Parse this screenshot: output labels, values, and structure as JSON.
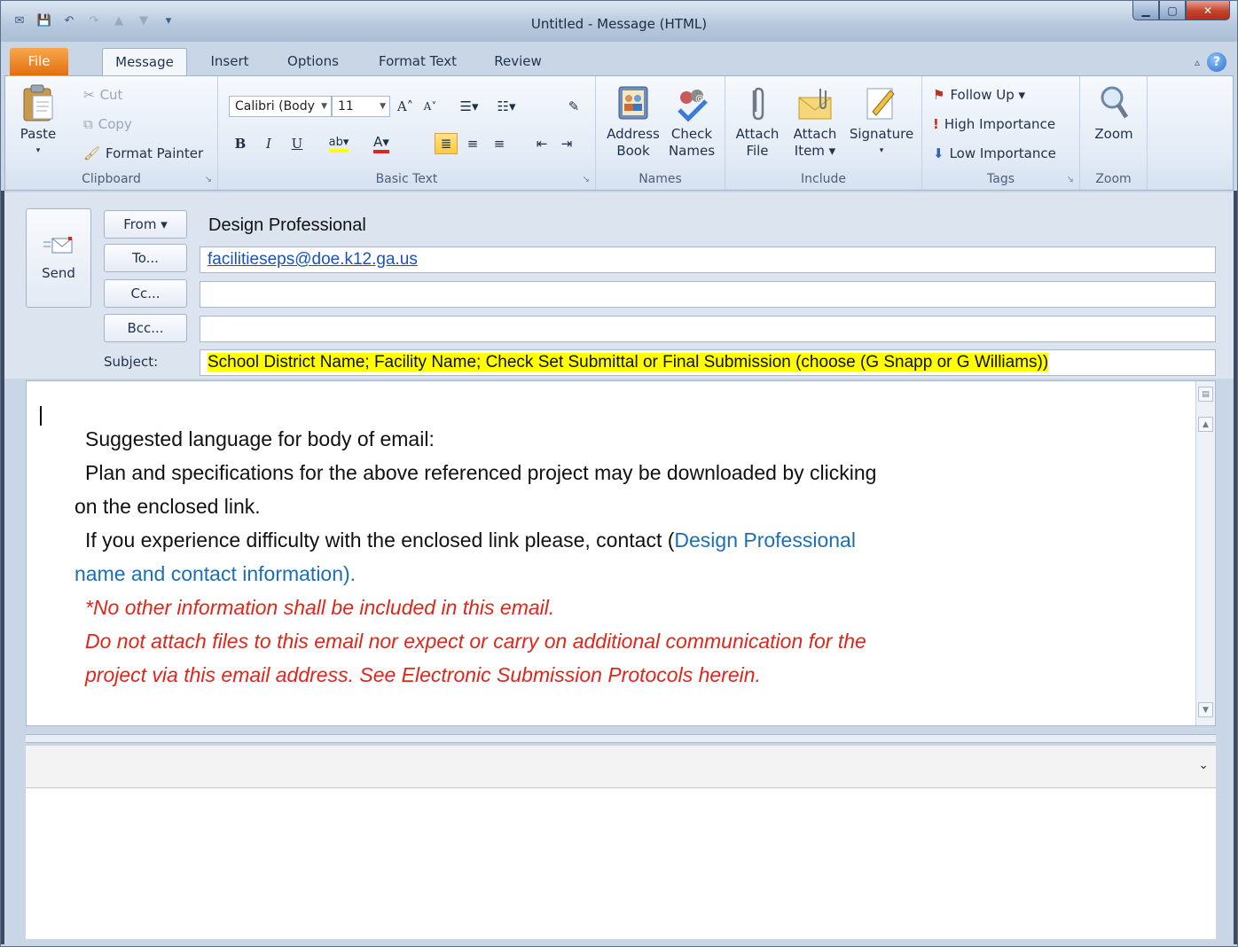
{
  "window": {
    "title": "Untitled - Message (HTML)"
  },
  "qat": {
    "save": "💾",
    "undo": "↶",
    "redo": "↷",
    "up": "▲",
    "down": "▼",
    "customize": "▾"
  },
  "tabs": [
    {
      "label": "File"
    },
    {
      "label": "Message"
    },
    {
      "label": "Insert"
    },
    {
      "label": "Options"
    },
    {
      "label": "Format Text"
    },
    {
      "label": "Review"
    }
  ],
  "ribbon": {
    "clipboard": {
      "label": "Clipboard",
      "paste": "Paste",
      "cut": "Cut",
      "copy": "Copy",
      "format_painter": "Format Painter"
    },
    "basic_text": {
      "label": "Basic Text",
      "font": "Calibri (Body",
      "size": "11"
    },
    "names": {
      "label": "Names",
      "address_book_1": "Address",
      "address_book_2": "Book",
      "check_names_1": "Check",
      "check_names_2": "Names"
    },
    "include": {
      "label": "Include",
      "attach_file_1": "Attach",
      "attach_file_2": "File",
      "attach_item_1": "Attach",
      "attach_item_2": "Item ▾",
      "signature": "Signature"
    },
    "tags": {
      "label": "Tags",
      "follow_up": "Follow Up ▾",
      "high_importance": "High Importance",
      "low_importance": "Low Importance"
    },
    "zoom": {
      "label": "Zoom",
      "button": "Zoom"
    }
  },
  "header": {
    "send": "Send",
    "from_button": "From ▾",
    "from_value": "Design Professional",
    "to_button": "To...",
    "to_value": "facilitieseps@doe.k12.ga.us",
    "cc_button": "Cc...",
    "bcc_button": "Bcc...",
    "subject_label": "Subject:",
    "subject_value": "School District Name; Facility Name; Check Set Submittal or Final Submission (choose (G Snapp or G Williams))"
  },
  "body": {
    "line1": "Suggested language for body of email:",
    "line2": "Plan and specifications for the above referenced project may be downloaded by clicking",
    "line3": "on the enclosed link.",
    "line4_prefix": "If you experience difficulty with the enclosed link please, contact (",
    "line4_blue": "Design Professional",
    "line5_blue": "name and contact information).",
    "line6": "*No other information shall be included in this email.",
    "line7": "Do not attach files to this email nor expect or carry on additional communication for the",
    "line8": "project via this email address. See Electronic Submission Protocols herein."
  },
  "people_pane": {
    "chevron": "⌄"
  },
  "colors": {
    "file_tab": "#e2700f",
    "highlight": "#ffff00",
    "link": "#1a53b8",
    "red_text": "#e0261a",
    "blue_text": "#1b6eb8"
  }
}
